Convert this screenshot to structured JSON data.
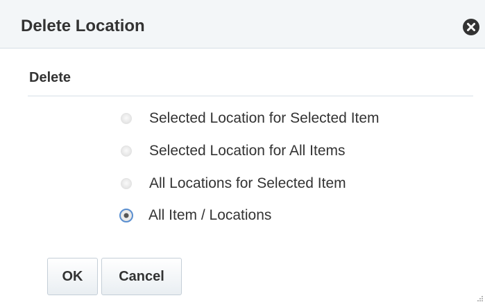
{
  "dialog": {
    "title": "Delete Location",
    "close_icon": "close-circle-icon"
  },
  "section": {
    "title": "Delete"
  },
  "options": [
    {
      "label": "Selected Location for Selected Item",
      "selected": false,
      "disabled": true
    },
    {
      "label": "Selected Location for All Items",
      "selected": false,
      "disabled": true
    },
    {
      "label": "All Locations for Selected Item",
      "selected": false,
      "disabled": true
    },
    {
      "label": "All Item / Locations",
      "selected": true,
      "disabled": false
    }
  ],
  "buttons": {
    "ok_label": "OK",
    "cancel_label": "Cancel"
  },
  "colors": {
    "header_bg": "#f3f6f8",
    "text": "#333333",
    "focus_ring": "#5a8fd0"
  }
}
